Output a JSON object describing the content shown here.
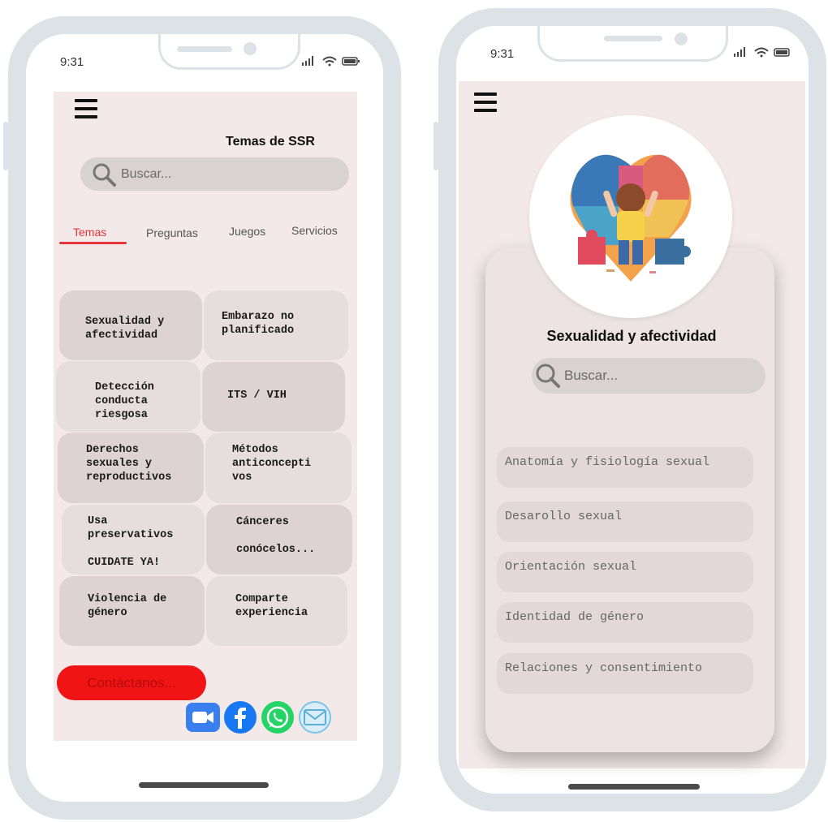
{
  "left_phone": {
    "status_time": "9:31",
    "header_title": "Temas de SSR",
    "search": {
      "placeholder": "Buscar..."
    },
    "tabs": [
      {
        "label": "Temas",
        "active": true
      },
      {
        "label": "Preguntas",
        "active": false
      },
      {
        "label": "Juegos",
        "active": false
      },
      {
        "label": "Servicios",
        "active": false
      }
    ],
    "tiles": [
      {
        "label": "Sexualidad y\nafectividad"
      },
      {
        "label": "Embarazo no\nplanificado"
      },
      {
        "label": "Detección\nconducta\nriesgosa"
      },
      {
        "label": "ITS / VIH"
      },
      {
        "label": "Derechos\nsexuales y\nreproductivos"
      },
      {
        "label": "Métodos\nanticoncepti\nvos"
      },
      {
        "label": "Usa\npreservativos\n\nCUIDATE YA!"
      },
      {
        "label": "Cánceres\n\nconócelos..."
      },
      {
        "label": "Violencia de\ngénero"
      },
      {
        "label": "Comparte\nexperiencia"
      }
    ],
    "contact_button": "Contáctanos...",
    "social": [
      "video-call-icon",
      "facebook-icon",
      "whatsapp-icon",
      "email-icon"
    ]
  },
  "right_phone": {
    "status_time": "9:31",
    "title": "Sexualidad y afectividad",
    "search": {
      "placeholder": "Buscar..."
    },
    "topics": [
      "Anatomía y fisiología sexual",
      "Desarollo sexual",
      "Orientación sexual",
      "Identidad de género",
      "Relaciones y consentimiento"
    ]
  },
  "colors": {
    "accent_red": "#e4323a",
    "contact_red": "#f01414",
    "screen_bg": "#f2e9e8",
    "frame": "#dde2e6"
  }
}
